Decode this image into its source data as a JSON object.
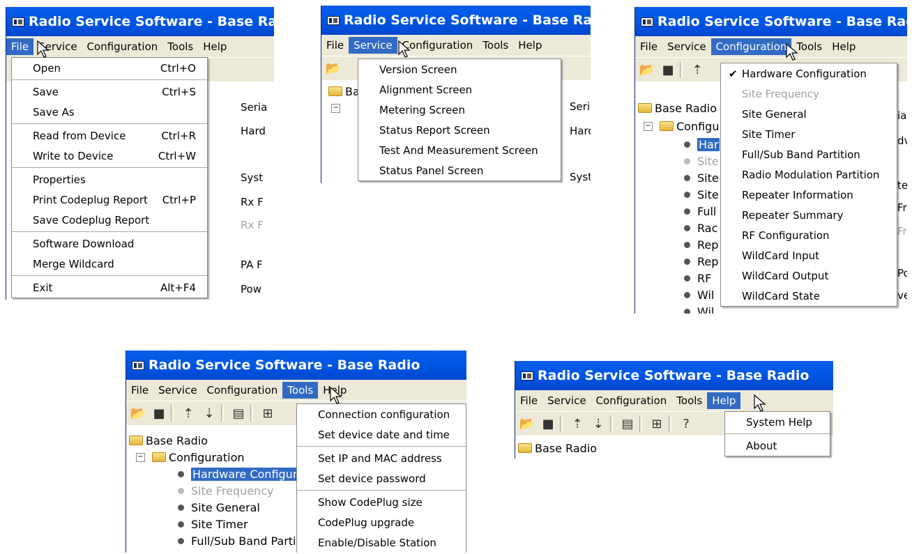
{
  "app_title": "Radio Service Software - Base Radio",
  "menubar": [
    "File",
    "Service",
    "Configuration",
    "Tools",
    "Help"
  ],
  "file_menu": {
    "groups": [
      [
        {
          "label": "Open",
          "shortcut": "Ctrl+O"
        }
      ],
      [
        {
          "label": "Save",
          "shortcut": "Ctrl+S"
        },
        {
          "label": "Save As",
          "shortcut": ""
        }
      ],
      [
        {
          "label": "Read from Device",
          "shortcut": "Ctrl+R"
        },
        {
          "label": "Write to Device",
          "shortcut": "Ctrl+W"
        }
      ],
      [
        {
          "label": "Properties",
          "shortcut": ""
        },
        {
          "label": "Print Codeplug Report",
          "shortcut": "Ctrl+P"
        },
        {
          "label": "Save Codeplug Report",
          "shortcut": ""
        }
      ],
      [
        {
          "label": "Software Download",
          "shortcut": ""
        },
        {
          "label": "Merge Wildcard",
          "shortcut": ""
        }
      ],
      [
        {
          "label": "Exit",
          "shortcut": "Alt+F4"
        }
      ]
    ],
    "panel_labels": [
      "Seria",
      "Hard",
      "Syst",
      "Rx F",
      "Rx F",
      "PA F",
      "Pow"
    ]
  },
  "service_menu": {
    "items": [
      "Version Screen",
      "Alignment Screen",
      "Metering Screen",
      "Status Report Screen",
      "Test And Measurement Screen",
      "Status Panel Screen"
    ],
    "tree_root": "Ba",
    "panel_labels": [
      "Seri",
      "Hard",
      "Syst"
    ]
  },
  "configuration_menu": {
    "items": [
      {
        "label": "Hardware Configuration",
        "checked": true,
        "disabled": false
      },
      {
        "label": "Site Frequency",
        "checked": false,
        "disabled": true
      },
      {
        "label": "Site General",
        "checked": false,
        "disabled": false
      },
      {
        "label": "Site Timer",
        "checked": false,
        "disabled": false
      },
      {
        "label": "Full/Sub Band Partition",
        "checked": false,
        "disabled": false
      },
      {
        "label": "Radio Modulation Partition",
        "checked": false,
        "disabled": false
      },
      {
        "label": "Repeater Information",
        "checked": false,
        "disabled": false
      },
      {
        "label": "Repeater Summary",
        "checked": false,
        "disabled": false
      },
      {
        "label": "RF Configuration",
        "checked": false,
        "disabled": false
      },
      {
        "label": "WildCard Input",
        "checked": false,
        "disabled": false
      },
      {
        "label": "WildCard Output",
        "checked": false,
        "disabled": false
      },
      {
        "label": "WildCard State",
        "checked": false,
        "disabled": false
      }
    ],
    "tree_root": "Base Radio",
    "tree_folder": "Configu",
    "tree_children": [
      "Har",
      "Site",
      "Site",
      "Site",
      "Full",
      "Rac",
      "Rep",
      "Rep",
      "RF",
      "Wil",
      "Wil"
    ],
    "panel_labels": [
      "ia",
      "dv",
      "te",
      "Fr",
      "Fr",
      "Po",
      "ve"
    ]
  },
  "tools_menu": {
    "groups": [
      [
        "Connection configuration",
        "Set device date and time"
      ],
      [
        "Set IP and MAC address",
        "Set device password"
      ],
      [
        "Show CodePlug size",
        "CodePlug upgrade",
        "Enable/Disable Station"
      ]
    ],
    "tree_root": "Base Radio",
    "tree_folder": "Configuration",
    "tree_children": [
      "Hardware Configur",
      "Site Frequency",
      "Site General",
      "Site Timer",
      "Full/Sub Band Partit"
    ]
  },
  "help_menu": {
    "items": [
      "System Help",
      "About"
    ],
    "tree_root": "Base Radio"
  },
  "colors": {
    "titlebar": "#0058e6",
    "menu_highlight": "#316ac5",
    "chrome": "#ece9d8"
  }
}
